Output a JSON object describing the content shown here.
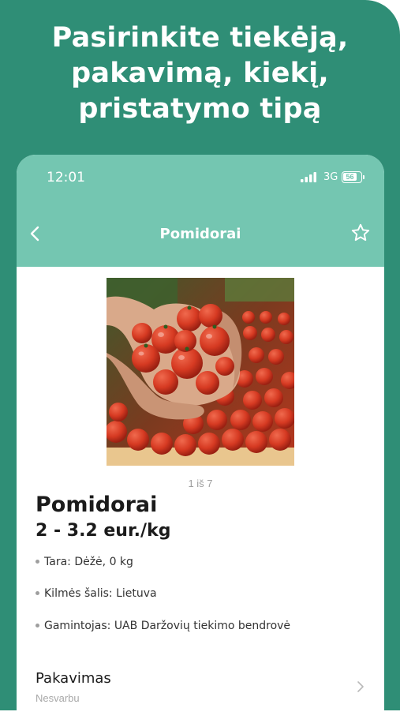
{
  "headline": {
    "line1": "Pasirinkite tiekėją,",
    "line2": "pakavimą, kiekį,",
    "line3": "pristatymo tipą"
  },
  "status_bar": {
    "time": "12:01",
    "network": "3G",
    "battery": "56"
  },
  "navbar": {
    "title": "Pomidorai",
    "back_icon": "chevron-left-icon",
    "favorite_icon": "star-outline-icon"
  },
  "product": {
    "image_pager": "1 iš 7",
    "name": "Pomidorai",
    "price": "2 - 3.2 eur./kg",
    "attributes": [
      "Tara: Dėžė, 0 kg",
      "Kilmės šalis: Lietuva",
      "Gamintojas: UAB Daržovių tiekimo bendrovė"
    ]
  },
  "packaging": {
    "label": "Pakavimas",
    "value": "Nesvarbu"
  },
  "colors": {
    "brand_dark": "#2f8e76",
    "brand_light": "#74c6b1",
    "tomato": "#d63a22"
  }
}
